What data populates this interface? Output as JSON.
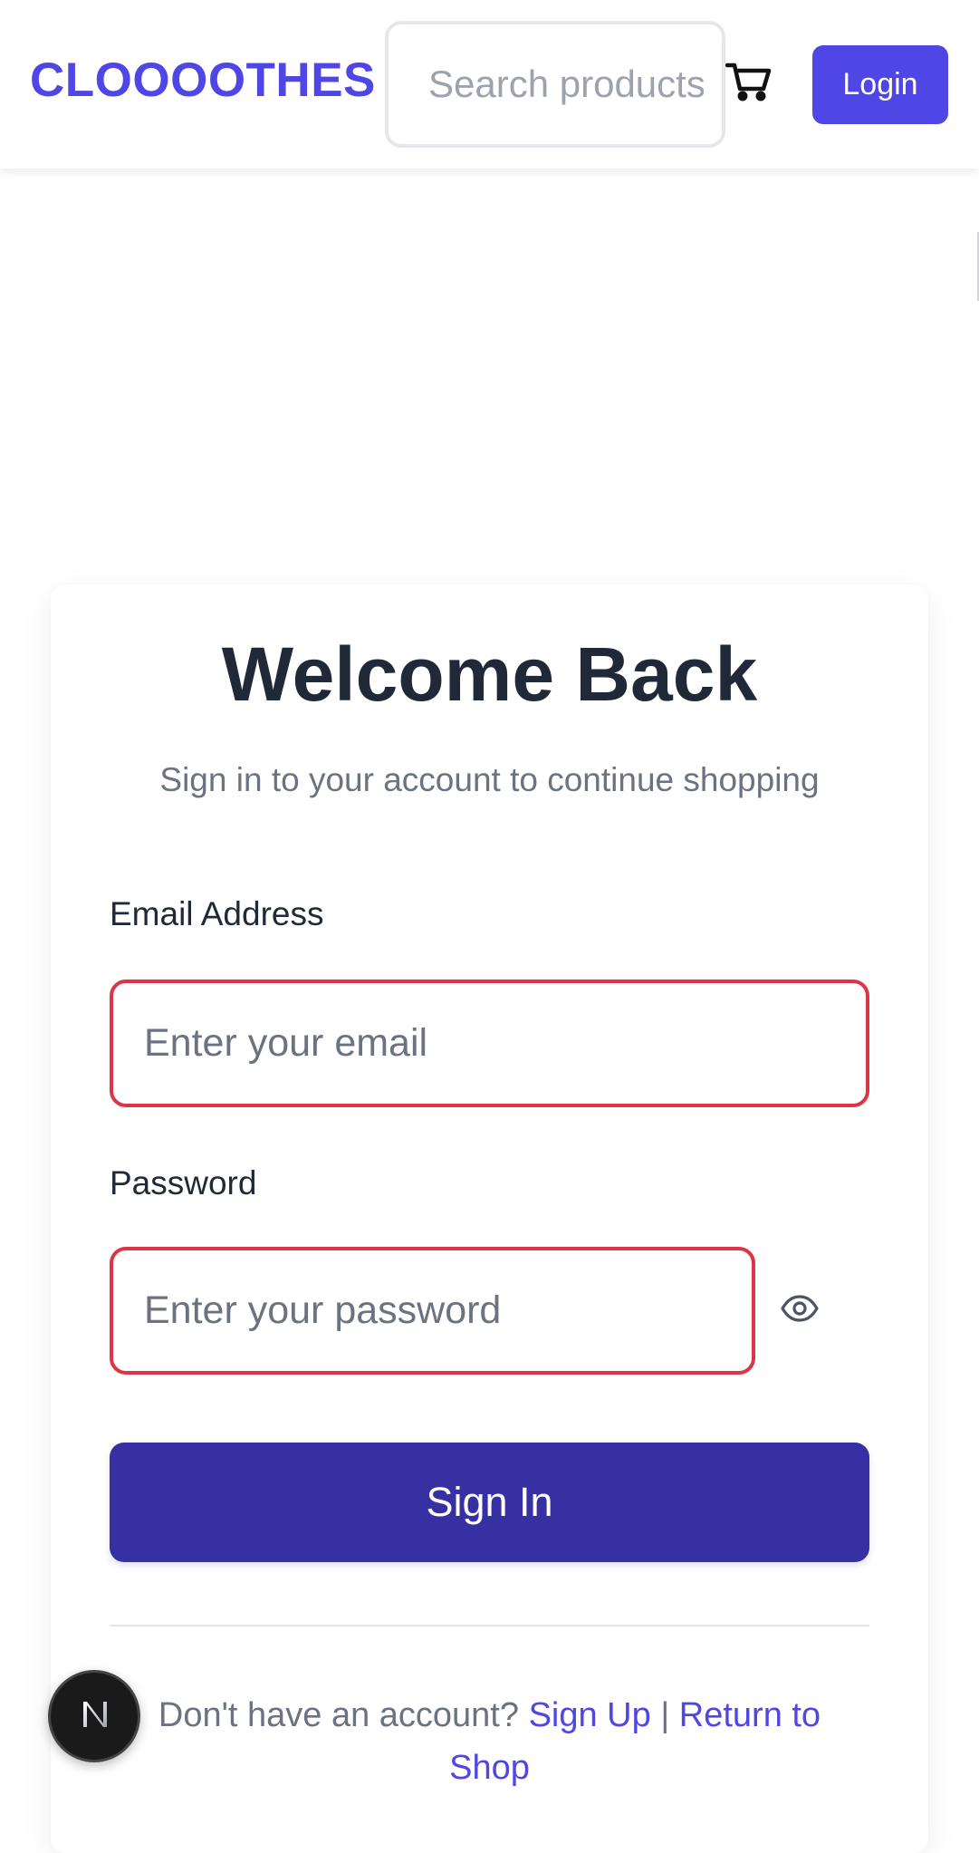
{
  "header": {
    "brand": "CLOOOOTHES",
    "search_placeholder": "Search products...",
    "cart_icon": "cart-icon",
    "login_label": "Login"
  },
  "form": {
    "title": "Welcome Back",
    "subtitle": "Sign in to your account to continue shopping",
    "email_label": "Email Address",
    "email_placeholder": "Enter your email",
    "email_value": "",
    "password_label": "Password",
    "password_placeholder": "Enter your password",
    "password_value": "",
    "show_password_icon": "eye-icon",
    "submit_label": "Sign In"
  },
  "footer": {
    "prompt": "Don't have an account?",
    "signup_link": "Sign Up",
    "separator": "|",
    "return_link": "Return to Shop"
  },
  "devtools": {
    "badge_letter": "N"
  },
  "colors": {
    "brand": "#4f46e5",
    "primary_button": "#3730a3",
    "error_border": "#dc3545",
    "title_text": "#1f2937",
    "muted_text": "#6b7280"
  }
}
